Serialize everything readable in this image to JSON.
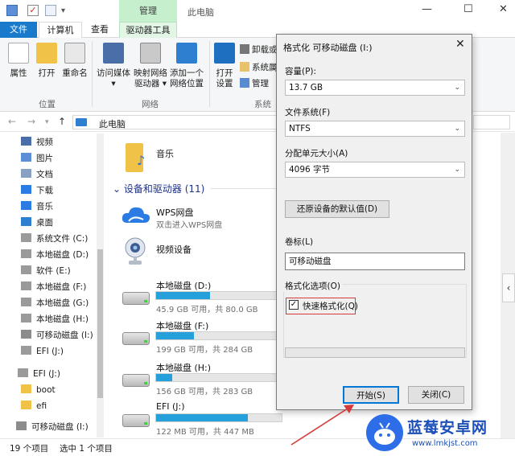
{
  "window": {
    "title": "此电脑",
    "manage_tab": "管理"
  },
  "tabs": {
    "file": "文件",
    "computer": "计算机",
    "view": "查看",
    "drive_tools": "驱动器工具"
  },
  "ribbon": {
    "location": {
      "label": "位置",
      "properties": "属性",
      "open": "打开",
      "rename": "重命名"
    },
    "network": {
      "label": "网络",
      "access_media": "访问媒体",
      "map_drive_1": "映射网络",
      "map_drive_2": "驱动器",
      "add_location_1": "添加一个",
      "add_location_2": "网络位置"
    },
    "system": {
      "label": "系统",
      "open_settings_1": "打开",
      "open_settings_2": "设置",
      "uninstall": "卸载或",
      "system_props": "系统属",
      "manage": "管理"
    }
  },
  "address": {
    "path": "此电脑"
  },
  "nav": {
    "items": [
      {
        "label": "视频",
        "icon": "video-icon"
      },
      {
        "label": "图片",
        "icon": "pictures-icon"
      },
      {
        "label": "文档",
        "icon": "documents-icon"
      },
      {
        "label": "下载",
        "icon": "downloads-icon"
      },
      {
        "label": "音乐",
        "icon": "music-icon"
      },
      {
        "label": "桌面",
        "icon": "desktop-icon"
      },
      {
        "label": "系统文件 (C:)",
        "icon": "drive-icon"
      },
      {
        "label": "本地磁盘 (D:)",
        "icon": "drive-icon"
      },
      {
        "label": "软件 (E:)",
        "icon": "drive-icon"
      },
      {
        "label": "本地磁盘 (F:)",
        "icon": "drive-icon"
      },
      {
        "label": "本地磁盘 (G:)",
        "icon": "drive-icon"
      },
      {
        "label": "本地磁盘 (H:)",
        "icon": "drive-icon"
      },
      {
        "label": "可移动磁盘 (I:)",
        "icon": "usb-drive-icon"
      },
      {
        "label": "EFI (J:)",
        "icon": "drive-icon"
      },
      {
        "label": "EFI (J:)",
        "icon": "drive-icon"
      },
      {
        "label": "boot",
        "icon": "folder-icon"
      },
      {
        "label": "efi",
        "icon": "folder-icon"
      },
      {
        "label": "可移动磁盘 (I:)",
        "icon": "usb-drive-icon"
      }
    ]
  },
  "content": {
    "music": "音乐",
    "section_title": "设备和驱动器 (11)",
    "wps_title": "WPS网盘",
    "wps_sub": "双击进入WPS网盘",
    "camera": "视频设备",
    "drives": [
      {
        "name": "本地磁盘 (D:)",
        "info": "45.9 GB 可用，共 80.0 GB",
        "used_fraction": 0.43
      },
      {
        "name": "本地磁盘 (F:)",
        "info": "199 GB 可用，共 284 GB",
        "used_fraction": 0.3
      },
      {
        "name": "本地磁盘 (H:)",
        "info": "156 GB 可用，共 283 GB",
        "used_fraction": 0.13
      },
      {
        "name": "EFI (J:)",
        "info": "122 MB 可用，共 447 MB",
        "used_fraction": 0.73
      }
    ]
  },
  "status": {
    "count": "19 个项目",
    "selected": "选中 1 个项目"
  },
  "dialog": {
    "title": "格式化 可移动磁盘 (I:)",
    "capacity_label": "容量(P):",
    "capacity_value": "13.7 GB",
    "fs_label": "文件系统(F)",
    "fs_value": "NTFS",
    "alloc_label": "分配单元大小(A)",
    "alloc_value": "4096 字节",
    "restore_button": "还原设备的默认值(D)",
    "volume_label": "卷标(L)",
    "volume_value": "可移动磁盘",
    "options_label": "格式化选项(O)",
    "quick_format": "快速格式化(Q)",
    "quick_format_checked": true,
    "start_button": "开始(S)",
    "close_button": "关闭(C)"
  },
  "watermark": {
    "name": "蓝莓安卓网",
    "url": "www.lmkjst.com"
  },
  "colors": {
    "accent": "#1979ca",
    "manage_tab": "#c6efce",
    "bar_fill": "#26a0da",
    "highlight_box": "#d43a3a"
  }
}
